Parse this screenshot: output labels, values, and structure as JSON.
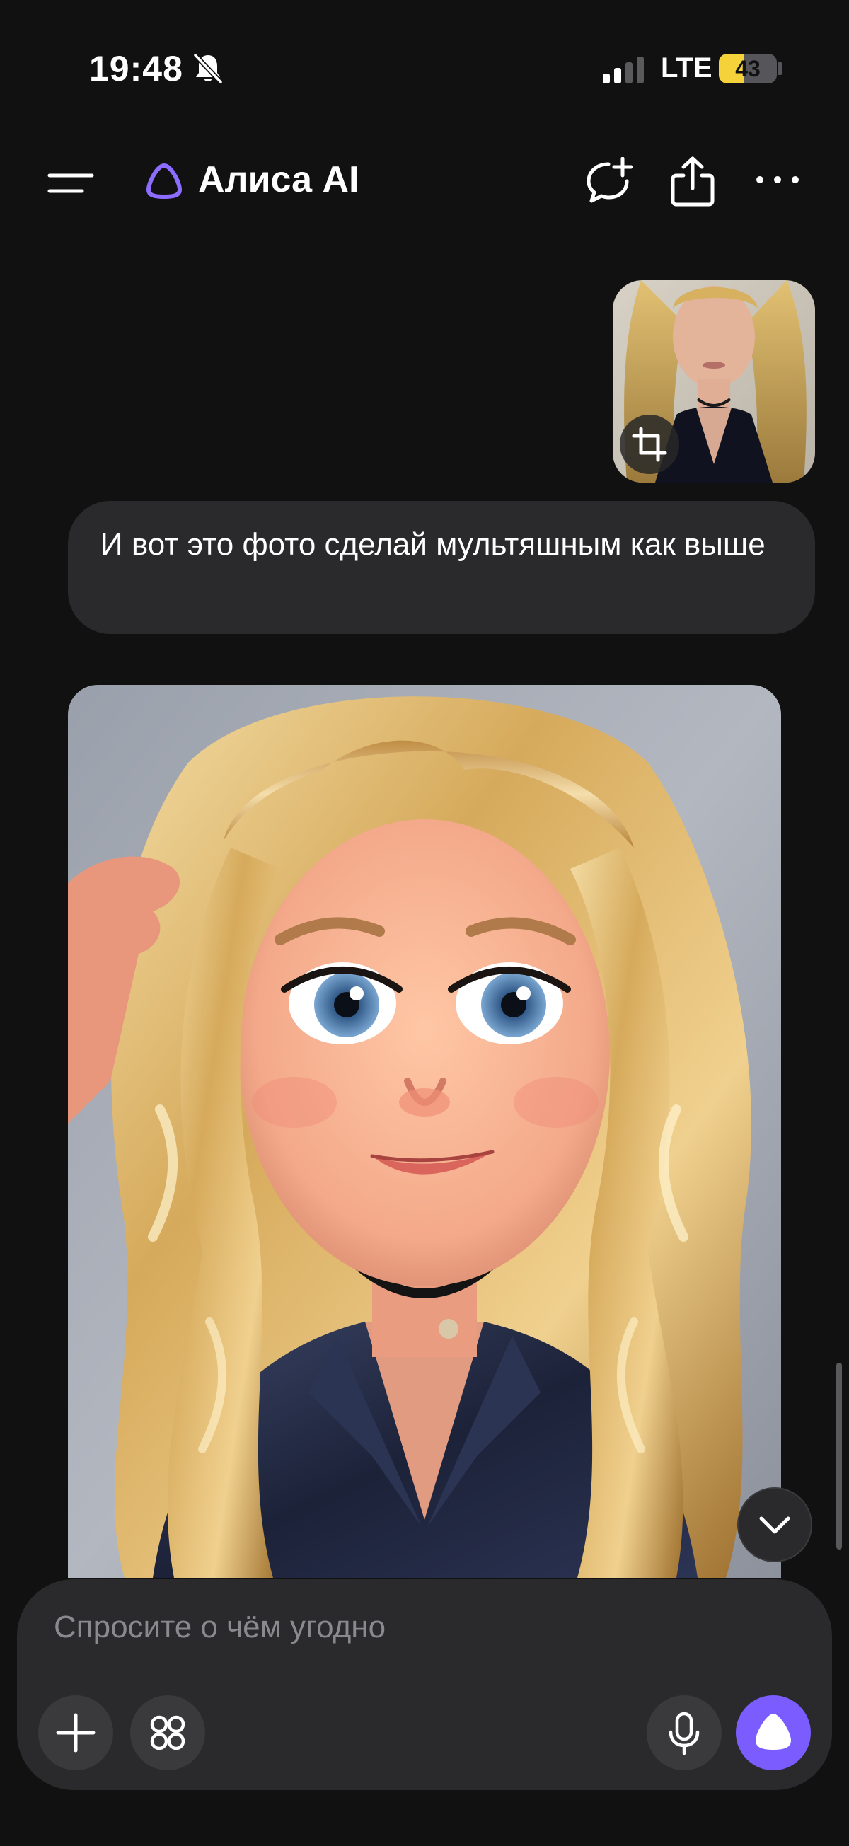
{
  "status_bar": {
    "time": "19:48",
    "network": "LTE",
    "battery_percent": "43",
    "battery_level": 0.43,
    "icons": [
      "bell-off-icon",
      "signal-bars-icon",
      "battery-icon"
    ],
    "battery_color": "#f5d23a"
  },
  "header": {
    "title": "Алиса AI",
    "icons": [
      "menu-icon",
      "alice-logo-icon",
      "new-chat-icon",
      "share-icon",
      "more-icon"
    ],
    "accent_color": "#7a5cff"
  },
  "chat": {
    "messages": [
      {
        "role": "user",
        "type": "image",
        "icons": [
          "crop-icon"
        ]
      },
      {
        "role": "user",
        "type": "text",
        "text": "И вот это фото сделай мультяшным как выше"
      },
      {
        "role": "assistant",
        "type": "image"
      }
    ],
    "scroll_down_icon": "chevron-down-icon"
  },
  "composer": {
    "placeholder": "Спросите о чём угодно",
    "value": "",
    "icons": [
      "plus-icon",
      "apps-icon",
      "microphone-icon",
      "alice-send-icon"
    ],
    "send_color": "#7a5cff"
  }
}
